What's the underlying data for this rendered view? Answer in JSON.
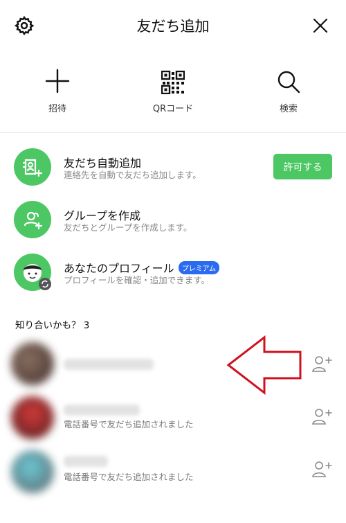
{
  "header": {
    "title": "友だち追加"
  },
  "actions": [
    {
      "label": "招待",
      "icon": "plus-icon"
    },
    {
      "label": "QRコード",
      "icon": "qr-code-icon"
    },
    {
      "label": "検索",
      "icon": "search-icon"
    }
  ],
  "options": [
    {
      "title": "友だち自動追加",
      "subtitle": "連絡先を自動で友だち追加します。",
      "button": "許可する",
      "icon": "contact-add-icon"
    },
    {
      "title": "グループを作成",
      "subtitle": "友だちとグループを作成します。",
      "icon": "group-add-icon"
    },
    {
      "title": "あなたのプロフィール",
      "badge": "プレミアム",
      "subtitle": "プロフィールを確認・追加できます。",
      "icon": "profile-avatar-icon"
    }
  ],
  "suggestions": {
    "label": "知り合いかも？ 3",
    "items": [
      {
        "subtitle": ""
      },
      {
        "subtitle": "電話番号で友だち追加されました"
      },
      {
        "subtitle": "電話番号で友だち追加されました"
      }
    ]
  },
  "colors": {
    "accent": "#4cc764",
    "badge": "#2b6bf0",
    "arrow": "#d0101f"
  }
}
